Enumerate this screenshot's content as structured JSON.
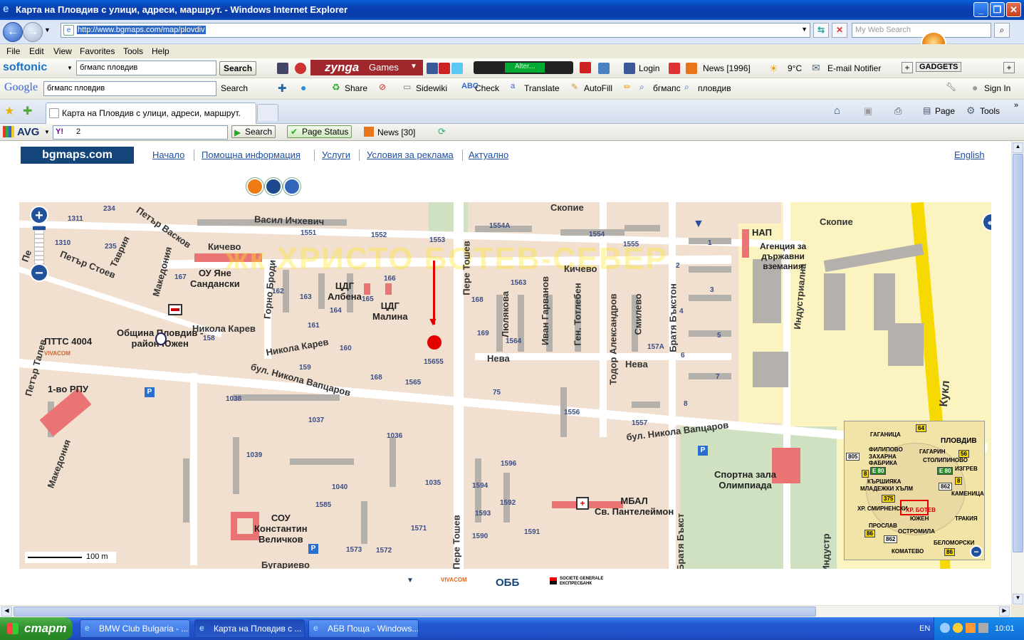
{
  "window": {
    "title": "Карта на Пловдив с улици, адреси, маршрут. - Windows Internet Explorer",
    "url": "http://www.bgmaps.com/map/plovdiv",
    "search_placeholder": "My Web Search"
  },
  "menu": [
    "File",
    "Edit",
    "View",
    "Favorites",
    "Tools",
    "Help"
  ],
  "softonic_bar": {
    "brand": "softonic",
    "query": "бгмапс пловдив",
    "search_label": "Search",
    "zynga": "zynga",
    "games": "Games",
    "alter": "Alter...",
    "login": "Login",
    "news": "News [1996]",
    "temp": "9°C",
    "email": "E-mail Notifier",
    "gadgets": "GADGETS"
  },
  "google_bar": {
    "brand": "Google",
    "query": "бгмапс пловдив",
    "search": "Search",
    "share": "Share",
    "sidewiki": "Sidewiki",
    "check": "Check",
    "translate": "Translate",
    "autofill": "AutoFill",
    "term1": "бгмапс",
    "term2": "пловдив",
    "signin": "Sign In"
  },
  "tabs": {
    "active": "Карта на Пловдив с улици, адреси, маршрут.",
    "page_label": "Page",
    "tools_label": "Tools"
  },
  "avg_bar": {
    "brand": "AVG",
    "yahoo_value": "2",
    "search": "Search",
    "page_status": "Page Status",
    "news": "News [30]"
  },
  "site": {
    "logo": "bgmaps.com",
    "nav": [
      "Начало",
      "Помощна информация",
      "Услуги",
      "Условия за реклама",
      "Актуално"
    ],
    "english": "English"
  },
  "map": {
    "district_overlay": "жк ХРИСТО БОТЕВ-СЕВЕР",
    "streets": {
      "vasil_ichevich": "Васил Ичхевич",
      "kichevo": "Кичево",
      "kichevo2": "Кичево",
      "skopie1": "Скопие",
      "skopie2": "Скопие",
      "petar_vaskov": "Петър Васков",
      "petar_stoev": "Петър Стоев",
      "tavria": "Таврия",
      "makedonia": "Македония",
      "makedonia2": "Македония",
      "gorno_brodi": "Горно Броди",
      "nikola_karev": "Никола Карев",
      "nikola_karev2": "Никола Карев",
      "vaptsarov1": "бул. Никола Вапцаров",
      "vaptsarov2": "бул. Никола Вапцаров",
      "pere_toshev": "Пере Тошев",
      "pere_toshev2": "Пере Тошев",
      "lyulyakova": "Люлякова",
      "ivan_garvanov": "Иван Гарванов",
      "totleben": "Ген. Тотлебен",
      "todor_aleksandrov": "Тодор Александров",
      "smilevo": "Смилево",
      "bratya_bakston": "Братя Бъкстон",
      "bratya_bakston2": "Братя Бъкст",
      "industrialna": "Индустриална",
      "industrialna2": "Индустр",
      "neva1": "Нева",
      "neva2": "Нева",
      "petar_talev": "Петър Талев",
      "bugarievo": "Бугариево",
      "kukl": "Кукл",
      "pe": "Пе"
    },
    "pois": {
      "ou_yane": "ОУ Яне\nСандански",
      "cdg_albena": "ЦДГ\nАлбена",
      "cdg_malina": "ЦДГ\nМалина",
      "obshtina": "Община Пловдив -\nрайон Южен",
      "ptts": "ПТТС 4004",
      "vivacom": "VIVACOM",
      "rpu": "1-во РПУ",
      "nap": "НАП",
      "agency": "Агенция за\nдържавни\nвземания",
      "sport": "Спортна зала\nОлимпиада",
      "mbal": "МБАЛ\nСв. Пантелеймон",
      "sou": "СОУ\nКонстантин\nВеличков"
    },
    "numbers": [
      "234",
      "1311",
      "1310",
      "235",
      "167",
      "1551",
      "1552",
      "1553",
      "162",
      "163",
      "164",
      "165",
      "166",
      "1554А",
      "1554",
      "1555",
      "1",
      "2",
      "3",
      "4",
      "5",
      "6",
      "7",
      "8",
      "168",
      "1563",
      "1564",
      "169",
      "157А",
      "161",
      "158",
      "160",
      "159",
      "15655",
      "168",
      "1565",
      "75",
      "1556",
      "1557",
      "1038",
      "1037",
      "1036",
      "1039",
      "1040",
      "1035",
      "1596",
      "1594",
      "1592",
      "1593",
      "1585",
      "1571",
      "1573",
      "1572",
      "1590",
      "1591"
    ],
    "scale": "100 m"
  },
  "minimap": {
    "labels": [
      "ГАГАНИЦА",
      "ПЛОВДИВ",
      "ФИЛИПОВО",
      "ЗАХАРНА ФАБРИКА",
      "ГАГАРИН",
      "СТОЛИПИНОВО",
      "ИЗГРЕВ",
      "КЪРШИЯКА",
      "МЛАДЕЖКИ ХЪЛМ",
      "КАМЕНИЦА",
      "ХР. СМИРНЕНСКИ",
      "ХР. БОТЕВ",
      "ЮЖЕН",
      "ТРАКИЯ",
      "ПРОСЛАВ",
      "ОСТРОМИЛА",
      "БЕЛОМОРСКИ",
      "КОМАТЕВО"
    ],
    "badges": [
      "64",
      "805",
      "56",
      "8",
      "E 80",
      "E 80",
      "8",
      "862",
      "375",
      "86",
      "862",
      "86"
    ]
  },
  "sponsors": [
    "VIVACOM",
    "ОББ",
    "SOCIETE GENERALE ЕКСПРЕСБАНК"
  ],
  "taskbar": {
    "start": "старт",
    "tasks": [
      "BMW Club Bulgaria - ...",
      "Карта на Пловдив с ...",
      "АБВ Поща - Windows..."
    ],
    "lang": "EN",
    "time": "10:01"
  },
  "colors": {
    "map_bg": "#F1DFCF",
    "road": "#FFFFFF",
    "building": "#B4B0AC",
    "poi_building": "#EA7473",
    "park": "#CFE1C1",
    "industrial": "#FBF3C0",
    "highway": "#F6D900",
    "marker": "#E50000",
    "site_blue": "#14457A"
  }
}
